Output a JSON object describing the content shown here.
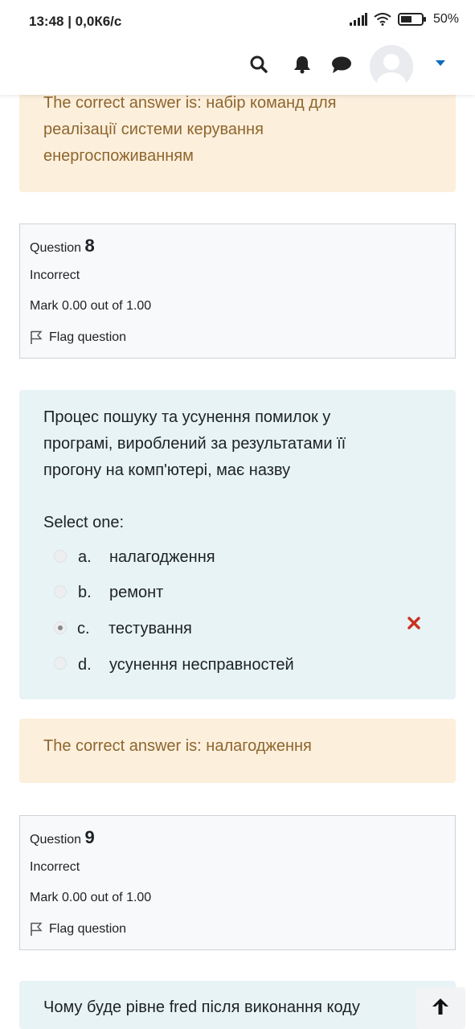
{
  "statusbar": {
    "time": "13:48 | 0,0К6/с",
    "battery": "50%"
  },
  "prev_feedback": {
    "text": "The correct answer is: набір команд для реалізації системи керування енергоспоживанням"
  },
  "q8": {
    "label": "Question",
    "number": "8",
    "state": "Incorrect",
    "mark": "Mark 0.00 out of 1.00",
    "flag": "Flag question",
    "text": "Процес пошуку та усунення помилок у програмі, вироблений за результатами її прогону на комп'ютері, має назву",
    "prompt": "Select one:",
    "options": [
      {
        "letter": "a.",
        "text": "налагодження",
        "checked": false
      },
      {
        "letter": "b.",
        "text": "ремонт",
        "checked": false
      },
      {
        "letter": "c.",
        "text": "тестування",
        "checked": true
      },
      {
        "letter": "d.",
        "text": "усунення несправностей",
        "checked": false
      }
    ],
    "feedback": "The correct answer is: налагодження"
  },
  "q9": {
    "label": "Question",
    "number": "9",
    "state": "Incorrect",
    "mark": "Mark 0.00 out of 1.00",
    "flag": "Flag question",
    "text": "Чому буде рівне fred після виконання коду"
  },
  "colors": {
    "feedback_bg": "#fcefdc",
    "feedback_text": "#8e662e",
    "question_bg": "#e7f3f5",
    "incorrect": "#ca3120",
    "accent": "#0f6cbf"
  }
}
